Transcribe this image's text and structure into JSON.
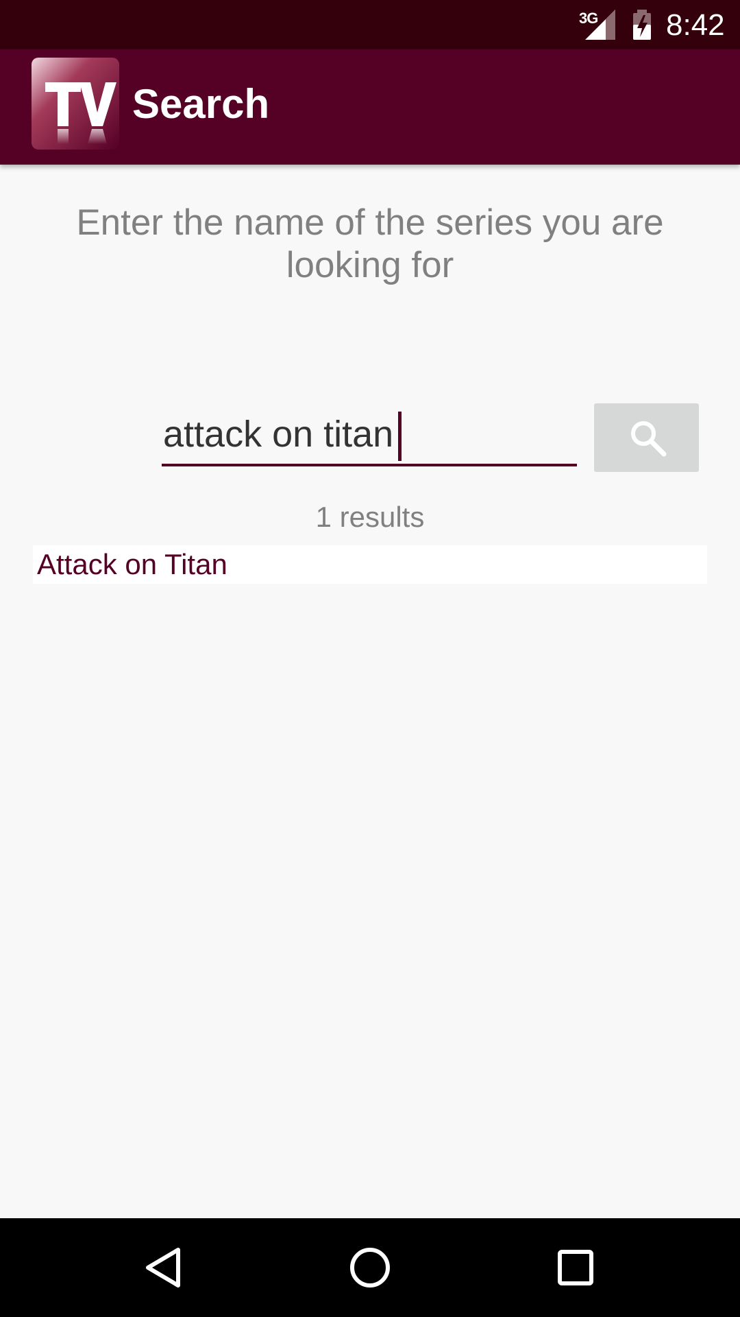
{
  "status_bar": {
    "network": "3G",
    "time": "8:42"
  },
  "app_bar": {
    "logo_text": "TV",
    "title": "Search"
  },
  "search": {
    "instruction": "Enter the name of the series you are looking for",
    "query": "attack on titan",
    "button_icon": "search-icon"
  },
  "results": {
    "count_label": "1 results",
    "items": [
      {
        "label": "Attack on Titan"
      }
    ]
  },
  "nav_bar": {
    "back_icon": "back-icon",
    "home_icon": "home-icon",
    "recents_icon": "recents-icon"
  },
  "colors": {
    "status_bar": "#33000b",
    "app_bar": "#550025",
    "background": "#f8f8f8",
    "accent": "#550025",
    "muted_text": "#808080",
    "button_bg": "#d6d7d7"
  }
}
